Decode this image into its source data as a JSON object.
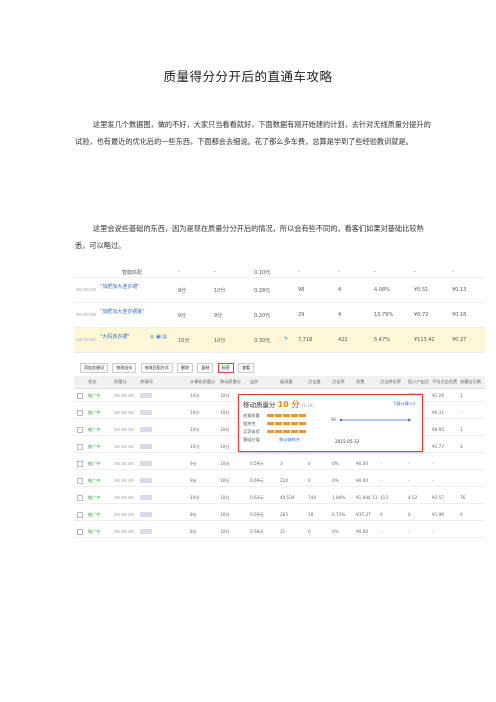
{
  "title": "质量得分分开后的直通车攻略",
  "paragraph1": "这里发几个数据图，做的不好，大家只当看看就好，下面数据有刚开始建的计划，去针对无线质量分提升的试验，也有最近的优化后的一些东西，下面都会去细说。花了那么多车费，总算是学到了些经验教训就是。",
  "paragraph2": "这里会说些基础的东西，因为是现在质量分分开后的情况，所以会有些不同的，看客们如果对基础比较熟悉，可以略过。",
  "shot1": {
    "rows": [
      {
        "kw": "智能匹配",
        "c1": "-",
        "c2": "-",
        "c3": "0.10元",
        "c4": "-",
        "c5": "-",
        "c6": "-",
        "c7": "-",
        "c8": "-"
      },
      {
        "kw": "\"加肥加大连衣裙\"",
        "c1": "9分",
        "c2": "10分",
        "c3": "0.28元",
        "c4": "98",
        "c5": "4",
        "c6": "4.08%",
        "c7": "¥0.51",
        "c8": "¥0.13"
      },
      {
        "kw": "\"加肥加大连衣裙夏\"",
        "c1": "9分",
        "c2": "9分",
        "c3": "0.20元",
        "c4": "29",
        "c5": "4",
        "c6": "13.79%",
        "c7": "¥0.72",
        "c8": "¥0.18"
      },
      {
        "kw": "\"大码连衣裙\"",
        "c1": "10分",
        "c2": "10分",
        "c3": "0.30元",
        "c4": "7,718",
        "c5": "422",
        "c6": "5.47%",
        "c7": "¥113.42",
        "c8": "¥0.27"
      }
    ]
  },
  "shot2": {
    "toolbar": [
      "添加关键词",
      "修改出价",
      "修改匹配方式",
      "删除",
      "复制",
      "标签",
      "查看"
    ],
    "header": [
      "状态",
      "质量分",
      "关键词",
      "计算机质量分",
      "移动质量分",
      "出价",
      "展现量",
      "点击量",
      "点击率",
      "花费",
      "点击转化率",
      "投入产出比",
      "平均点击花费",
      "收藏宝贝数"
    ],
    "rows": [
      {
        "status": "推广中",
        "a": "10分",
        "b": "10分",
        "c": "",
        "d": "",
        "e": "",
        "f": "",
        "g": "",
        "h": "",
        "i": "¥22.29",
        "j": "¥1.29",
        "k": "1"
      },
      {
        "status": "推广中",
        "a": "10分",
        "b": "10分",
        "c": "",
        "d": "",
        "e": "",
        "f": "",
        "g": "",
        "h": "",
        "i": "-",
        "j": "¥0.31",
        "k": "-"
      },
      {
        "status": "推广中",
        "a": "10分",
        "b": "10分",
        "c": "",
        "d": "",
        "e": "",
        "f": "",
        "g": "",
        "h": "",
        "i": "1.27",
        "j": "¥0.95",
        "k": "1"
      },
      {
        "status": "推广中",
        "a": "10分",
        "b": "10分",
        "c": "",
        "d": "",
        "e": "",
        "f": "",
        "g": "",
        "h": "",
        "i": "4.29",
        "j": "¥1.77",
        "k": "3"
      },
      {
        "status": "推广中",
        "a": "9分",
        "b": "10分",
        "c": "0.59元",
        "d": "3",
        "e": "0",
        "f": "0%",
        "g": "¥0.00",
        "h": "-",
        "i": "-",
        "j": "-",
        "k": ""
      },
      {
        "status": "推广中",
        "a": "9分",
        "b": "10分",
        "c": "0.69元",
        "d": "224",
        "e": "0",
        "f": "0%",
        "g": "¥0.00",
        "h": "-",
        "i": "-",
        "j": "-",
        "k": ""
      },
      {
        "status": "推广中",
        "a": "10分",
        "b": "10分",
        "c": "0.63元",
        "d": "40,534",
        "e": "744",
        "f": "1.84%",
        "g": "¥1,944.13",
        "h": "113",
        "i": "4.52",
        "j": "¥2.57",
        "k": "76"
      },
      {
        "status": "推广中",
        "a": "8分",
        "b": "10分",
        "c": "0.59元",
        "d": "265",
        "e": "18",
        "f": "6.72%",
        "g": "¥35.37",
        "h": "0",
        "i": "0",
        "j": "¥1.96",
        "k": "0"
      },
      {
        "status": "推广中",
        "a": "8分",
        "b": "10分",
        "c": "0.58元",
        "d": "11",
        "e": "0",
        "f": "0%",
        "g": "¥0.00",
        "h": "-",
        "i": "-",
        "j": "-",
        "k": ""
      }
    ],
    "popup": {
      "title": "移动质量分",
      "score": "10 分",
      "sub": "(1-10)",
      "link": "下载计算>>",
      "metrics": [
        "创意质量",
        "相关性",
        "买家体验"
      ],
      "extra": "基础分值",
      "note": "移动端排名",
      "y_max": "96",
      "date": "2015-05-12"
    }
  }
}
